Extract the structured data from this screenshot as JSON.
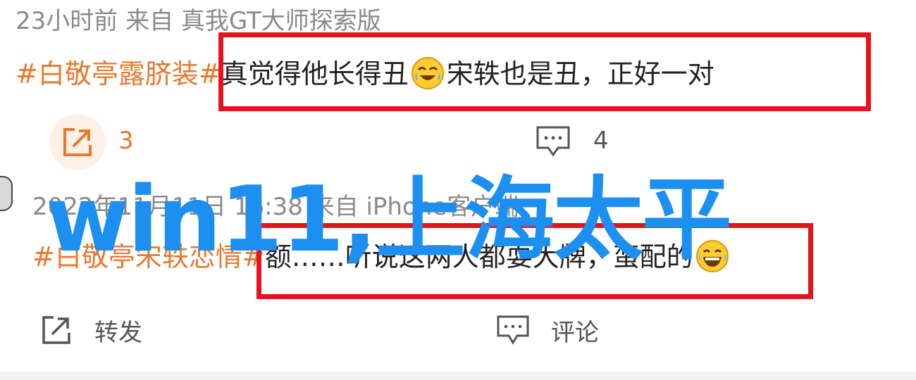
{
  "post1": {
    "meta": "23小时前  来自 真我GT大师探索版",
    "tag": "#白敬亭露脐装#",
    "text_before_emoji": "真觉得他长得丑",
    "text_after_emoji": "宋轶也是丑，正好一对",
    "emoji_icon": "laughing-tears-emoji",
    "repost_count": "3",
    "comment_count": "4"
  },
  "overlay_text": "win11,上海太平",
  "post2": {
    "meta": "2022年11月11日 16:38  来自 iPhone客户端",
    "tag": "#白敬亭宋轶恋情#",
    "text": "额……听说这两人都耍大牌，蛮配的",
    "emoji_icon": "laughing-emoji",
    "repost_label": "转发",
    "comment_label": "评论"
  },
  "colors": {
    "tag": "#e8782e",
    "highlight_box": "#e4141e",
    "overlay": "#1c8ff0",
    "meta": "#8a8a8a",
    "icon_orange": "#e8782e"
  }
}
